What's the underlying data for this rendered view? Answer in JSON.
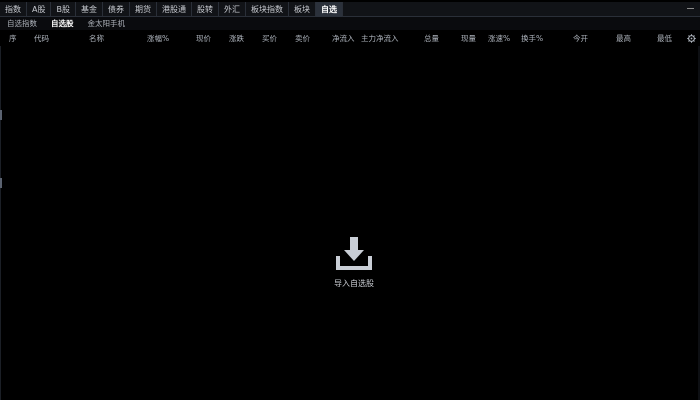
{
  "top_tabs": [
    "指数",
    "A股",
    "B股",
    "基金",
    "债券",
    "期货",
    "港股通",
    "股转",
    "外汇",
    "板块指数",
    "板块",
    "自选"
  ],
  "active_top_tab": 11,
  "sub_tabs": [
    "自选指数",
    "自选股",
    "金太阳手机"
  ],
  "active_sub_tab": 1,
  "columns": [
    "序",
    "代码",
    "名称",
    "涨幅%",
    "现价",
    "涨跌",
    "买价",
    "卖价",
    "净流入",
    "主力净流入",
    "总量",
    "现量",
    "涨速%",
    "换手%",
    "今开",
    "最高",
    "最低"
  ],
  "empty_state": {
    "icon": "import-download-icon",
    "label": "导入自选股"
  },
  "colors": {
    "background": "#000000",
    "tabbar": "#111317",
    "active_tab": "#2b313b",
    "text": "#c9ccd2",
    "icon": "#c9ced6"
  }
}
